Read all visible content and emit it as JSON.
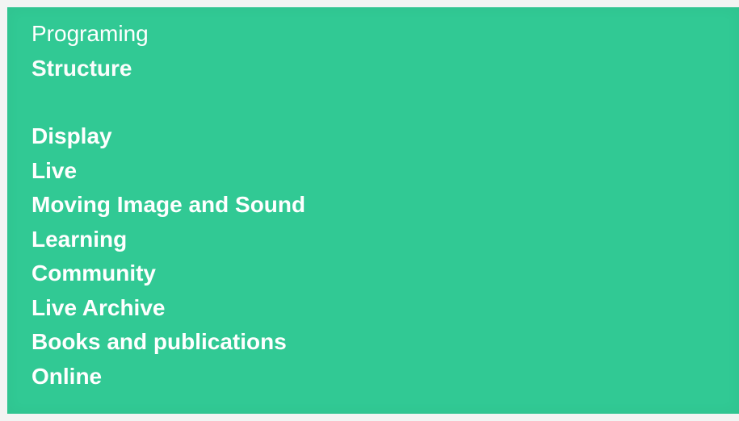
{
  "slide": {
    "background_color": "#31c994",
    "text_color": "#ffffff",
    "heading_lines": [
      "Programing",
      "Structure"
    ],
    "items": [
      "Display",
      "Live",
      "Moving Image and Sound",
      "Learning",
      "Community",
      "Live Archive",
      "Books and publications",
      "Online"
    ]
  }
}
